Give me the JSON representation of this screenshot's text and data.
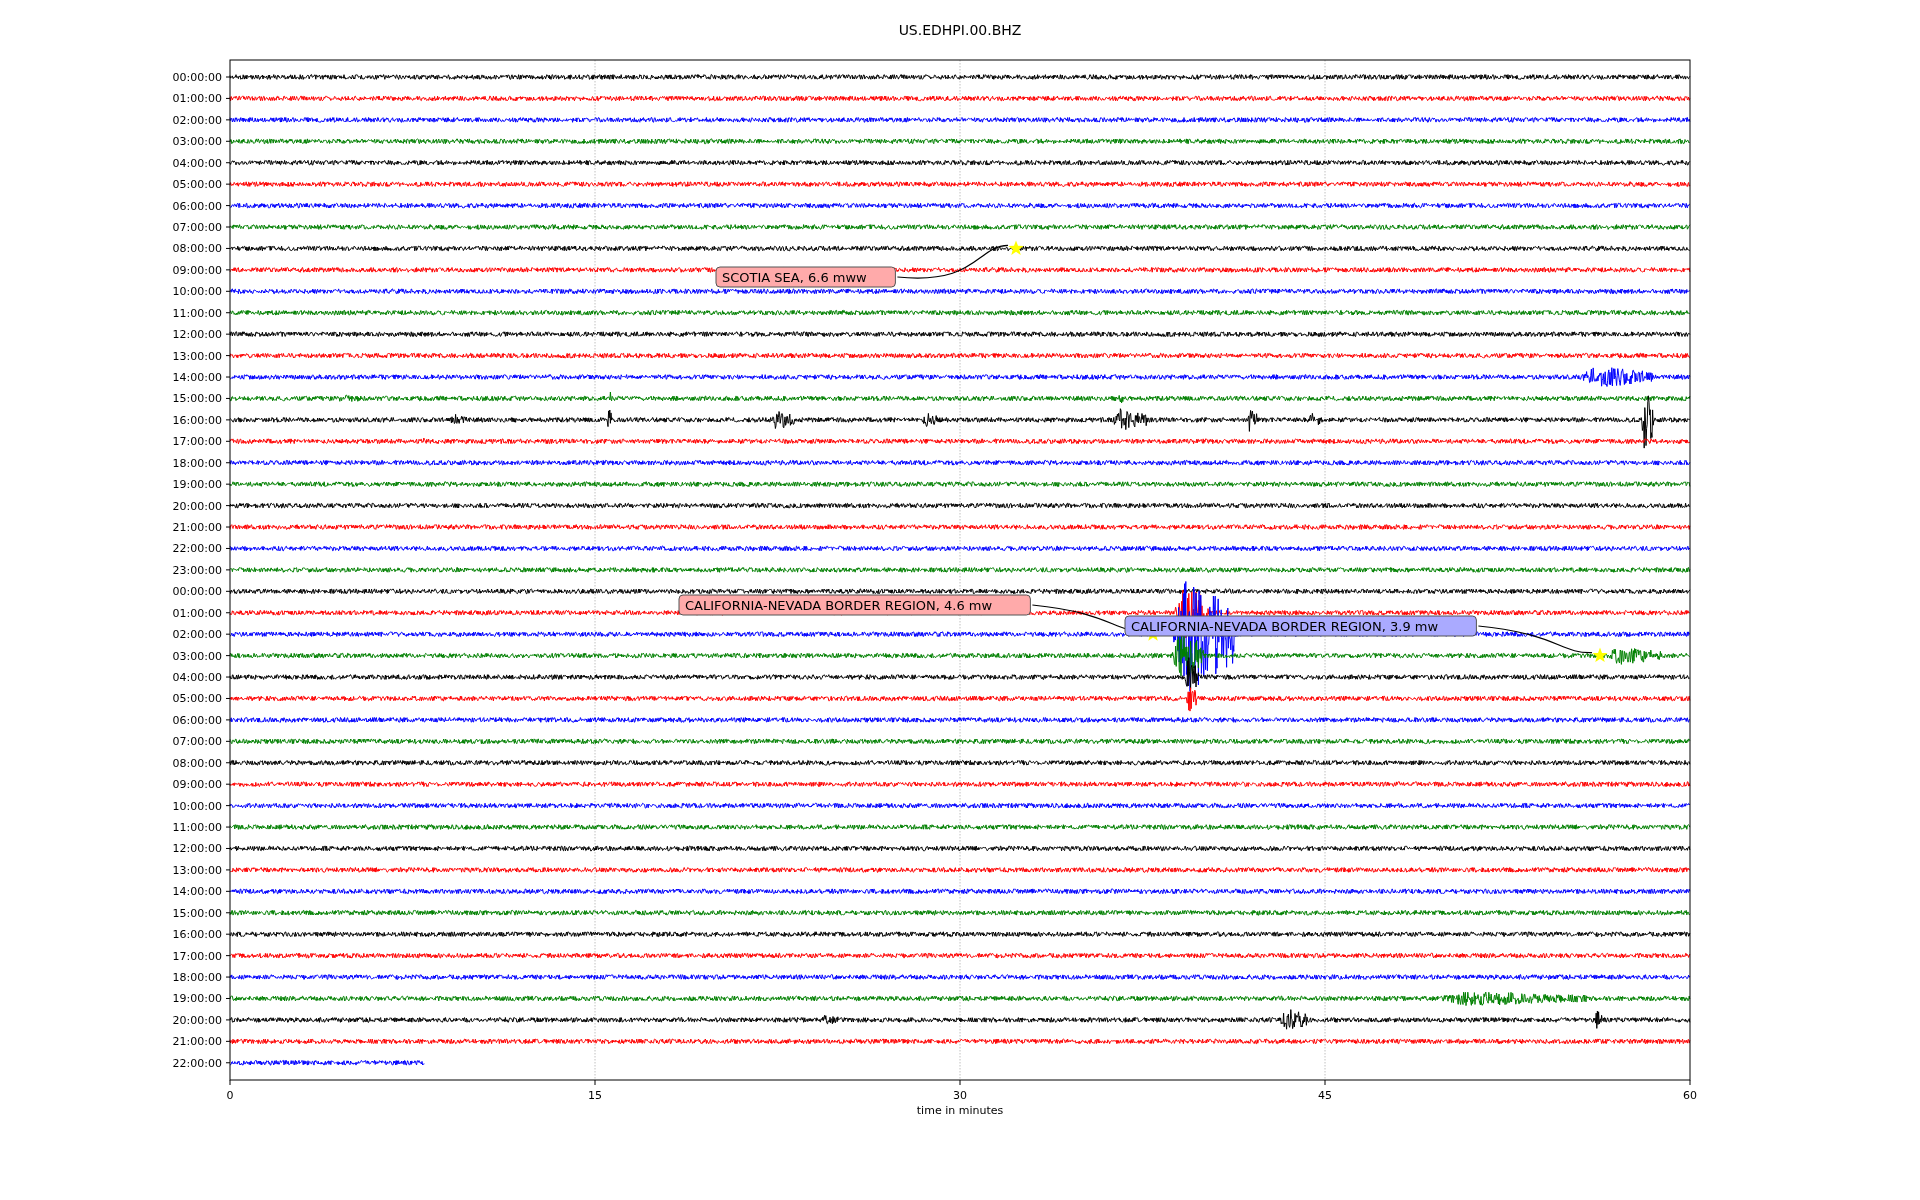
{
  "plot": {
    "title": "US.EDHPI.00.BHZ",
    "xlabel": "time in minutes",
    "xticks": [
      "0",
      "15",
      "30",
      "45",
      "60"
    ],
    "rows": [
      {
        "label": "00:00:00",
        "color": "#000000",
        "kind": "full"
      },
      {
        "label": "01:00:00",
        "color": "#ff0000",
        "kind": "full"
      },
      {
        "label": "02:00:00",
        "color": "#0000ff",
        "kind": "full"
      },
      {
        "label": "03:00:00",
        "color": "#008000",
        "kind": "full"
      },
      {
        "label": "04:00:00",
        "color": "#000000",
        "kind": "full"
      },
      {
        "label": "05:00:00",
        "color": "#ff0000",
        "kind": "full"
      },
      {
        "label": "06:00:00",
        "color": "#0000ff",
        "kind": "full"
      },
      {
        "label": "07:00:00",
        "color": "#008000",
        "kind": "full"
      },
      {
        "label": "08:00:00",
        "color": "#000000",
        "kind": "full"
      },
      {
        "label": "09:00:00",
        "color": "#ff0000",
        "kind": "full"
      },
      {
        "label": "10:00:00",
        "color": "#0000ff",
        "kind": "full"
      },
      {
        "label": "11:00:00",
        "color": "#008000",
        "kind": "full"
      },
      {
        "label": "12:00:00",
        "color": "#000000",
        "kind": "full"
      },
      {
        "label": "13:00:00",
        "color": "#ff0000",
        "kind": "full"
      },
      {
        "label": "14:00:00",
        "color": "#0000ff",
        "kind": "full"
      },
      {
        "label": "15:00:00",
        "color": "#008000",
        "kind": "full"
      },
      {
        "label": "16:00:00",
        "color": "#000000",
        "kind": "full"
      },
      {
        "label": "17:00:00",
        "color": "#ff0000",
        "kind": "full"
      },
      {
        "label": "18:00:00",
        "color": "#0000ff",
        "kind": "full"
      },
      {
        "label": "19:00:00",
        "color": "#008000",
        "kind": "full"
      },
      {
        "label": "20:00:00",
        "color": "#000000",
        "kind": "full"
      },
      {
        "label": "21:00:00",
        "color": "#ff0000",
        "kind": "full"
      },
      {
        "label": "22:00:00",
        "color": "#0000ff",
        "kind": "full"
      },
      {
        "label": "23:00:00",
        "color": "#008000",
        "kind": "full"
      },
      {
        "label": "00:00:00",
        "color": "#000000",
        "kind": "full"
      },
      {
        "label": "01:00:00",
        "color": "#ff0000",
        "kind": "full"
      },
      {
        "label": "02:00:00",
        "color": "#0000ff",
        "kind": "full"
      },
      {
        "label": "03:00:00",
        "color": "#008000",
        "kind": "full"
      },
      {
        "label": "04:00:00",
        "color": "#000000",
        "kind": "full"
      },
      {
        "label": "05:00:00",
        "color": "#ff0000",
        "kind": "full"
      },
      {
        "label": "06:00:00",
        "color": "#0000ff",
        "kind": "full"
      },
      {
        "label": "07:00:00",
        "color": "#008000",
        "kind": "full"
      },
      {
        "label": "08:00:00",
        "color": "#000000",
        "kind": "full"
      },
      {
        "label": "09:00:00",
        "color": "#ff0000",
        "kind": "full"
      },
      {
        "label": "10:00:00",
        "color": "#0000ff",
        "kind": "full"
      },
      {
        "label": "11:00:00",
        "color": "#008000",
        "kind": "full"
      },
      {
        "label": "12:00:00",
        "color": "#000000",
        "kind": "full"
      },
      {
        "label": "13:00:00",
        "color": "#ff0000",
        "kind": "full"
      },
      {
        "label": "14:00:00",
        "color": "#0000ff",
        "kind": "full"
      },
      {
        "label": "15:00:00",
        "color": "#008000",
        "kind": "full"
      },
      {
        "label": "16:00:00",
        "color": "#000000",
        "kind": "full"
      },
      {
        "label": "17:00:00",
        "color": "#ff0000",
        "kind": "full"
      },
      {
        "label": "18:00:00",
        "color": "#0000ff",
        "kind": "full"
      },
      {
        "label": "19:00:00",
        "color": "#008000",
        "kind": "full"
      },
      {
        "label": "20:00:00",
        "color": "#000000",
        "kind": "full"
      },
      {
        "label": "21:00:00",
        "color": "#ff0000",
        "kind": "full"
      },
      {
        "label": "22:00:00",
        "color": "#0000ff",
        "kind": "partial"
      }
    ],
    "events": [
      {
        "label": "SCOTIA SEA, 6.6 mww",
        "color": "#ffaaaa"
      },
      {
        "label": "CALIFORNIA-NEVADA BORDER REGION, 4.6 mw",
        "color": "#ffaaaa"
      },
      {
        "label": "CALIFORNIA-NEVADA BORDER REGION, 3.9 mw",
        "color": "#aaaaff"
      }
    ]
  }
}
